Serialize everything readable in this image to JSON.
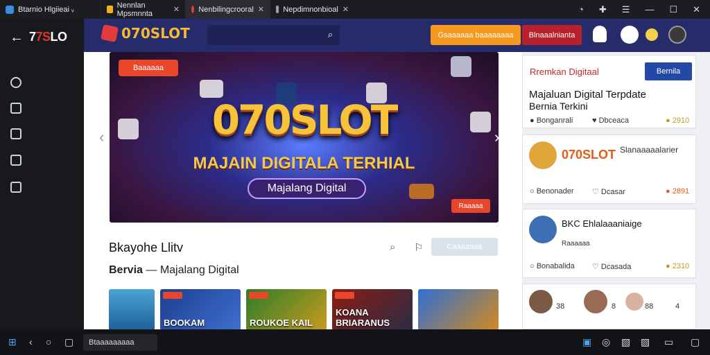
{
  "titlebar": {
    "app_title": "Btarnio Hlgiieai ᵥ",
    "tabs": [
      {
        "label": "Nennlan Mpsmnnta",
        "close": "✕"
      },
      {
        "label": "Nenbilingcrooral",
        "close": "✕"
      },
      {
        "label": "Nepdimnonbioal",
        "close": "✕"
      }
    ],
    "controls": [
      "◔",
      "✚",
      "☰",
      "—",
      "☐",
      "✕"
    ]
  },
  "sidebar": {
    "back": "←",
    "brand_a": "7",
    "brand_b": "7S",
    "brand_c": "LO",
    "icons": [
      "puzzle-icon",
      "inbox-icon",
      "calendar-icon",
      "card-icon",
      "image-icon"
    ]
  },
  "header": {
    "logo_text": "070SLOT",
    "search_icon": "⌕",
    "btn_primary": "Gsaaaaaa baaaaaaaa",
    "btn_secondary": "Blnaaalnianta",
    "colors": {
      "header_bg": "#262b6b",
      "accent_orange": "#f59a1f",
      "accent_red": "#b8202b"
    }
  },
  "banner": {
    "chip": "Baaaaaa",
    "headline": "070SLOT",
    "subheadline": "MAJAIN DIGITALA TERHIAL",
    "pill": "Majalang Digital",
    "corner_button": "Raaaaa",
    "prev": "‹",
    "next": "›"
  },
  "section": {
    "title": "Bkayohe Llitv",
    "subtitle_bold": "Bervia",
    "subtitle_rest": " — Majalang Digital",
    "action_button": "Caaaaaaa",
    "thumbs": [
      {
        "label": ""
      },
      {
        "label": "BOOKAM"
      },
      {
        "label": "ROUKOE KAIL"
      },
      {
        "label": "KOANA BRIARANUS"
      },
      {
        "label": ""
      }
    ]
  },
  "cards": [
    {
      "title": "Rremkan Digitaal",
      "button": "Bernila",
      "heading": "Majaluan Digital Terpdate",
      "subheading": "Bernia Terkini",
      "stats": [
        "Bonganrali",
        "Dbceaca",
        "2910"
      ]
    },
    {
      "title": "070SLOT",
      "headline_right": "Slanaaaaalarier",
      "stats": [
        "Benonader",
        "Dcasar",
        "2891"
      ]
    },
    {
      "title": "BKC Ehlalaaaniaige",
      "subtitle": "Raaaaaa",
      "stats": [
        "Bonabalida",
        "Dcasada",
        "2310"
      ]
    },
    {
      "avatars": [
        "38",
        "8",
        "88",
        "4"
      ]
    }
  ],
  "taskbar": {
    "search_field": "Btaaaaaaaaa",
    "left_icons": [
      "⊞",
      "‹",
      "○",
      "▢"
    ],
    "right_icons": [
      "▣",
      "◎",
      "▧",
      "▨",
      "▭",
      "▢"
    ]
  }
}
